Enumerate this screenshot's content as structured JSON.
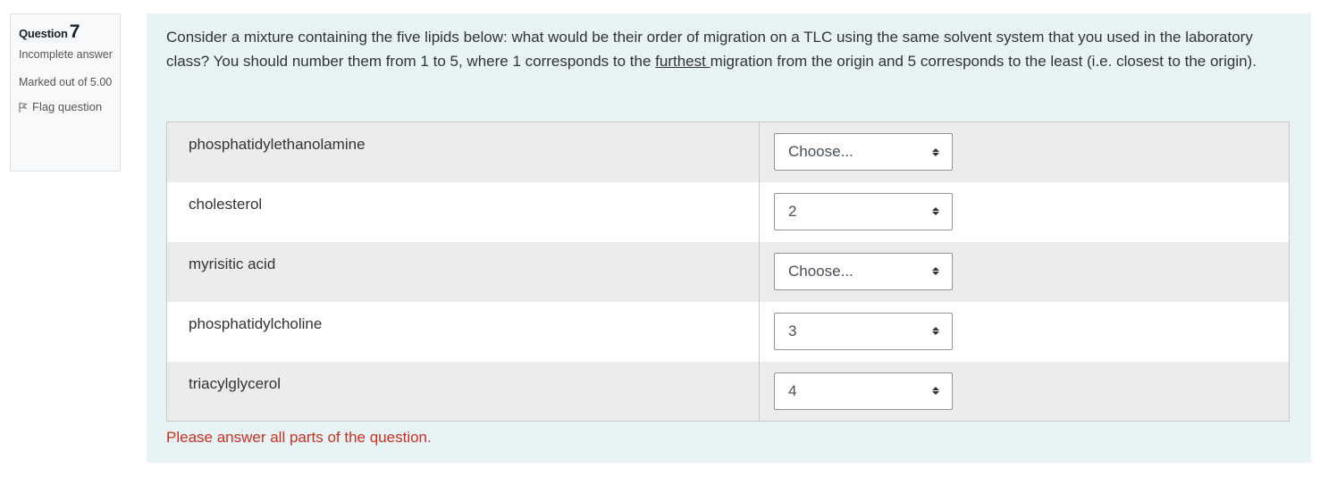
{
  "info": {
    "question_label": "Question",
    "question_number": "7",
    "state": "Incomplete answer",
    "grade": "Marked out of 5.00",
    "flag_label": "Flag question"
  },
  "question": {
    "text_before": "Consider a mixture containing the five lipids below: what would be their order of migration on a TLC using the same solvent system that you used in the laboratory class? You should number them from 1 to 5, where 1 corresponds to the ",
    "underlined": "furthest ",
    "text_after": "migration from the origin and 5 corresponds to the least (i.e. closest to the origin)."
  },
  "rows": [
    {
      "label": "phosphatidylethanolamine",
      "value": "Choose..."
    },
    {
      "label": "cholesterol",
      "value": "2"
    },
    {
      "label": "myrisitic acid",
      "value": "Choose..."
    },
    {
      "label": "phosphatidylcholine",
      "value": "3"
    },
    {
      "label": "triacylglycerol",
      "value": "4"
    }
  ],
  "validation_message": "Please answer all parts of the question.",
  "colors": {
    "panel_background": "#e7f3f5",
    "error": "#ca3120"
  }
}
